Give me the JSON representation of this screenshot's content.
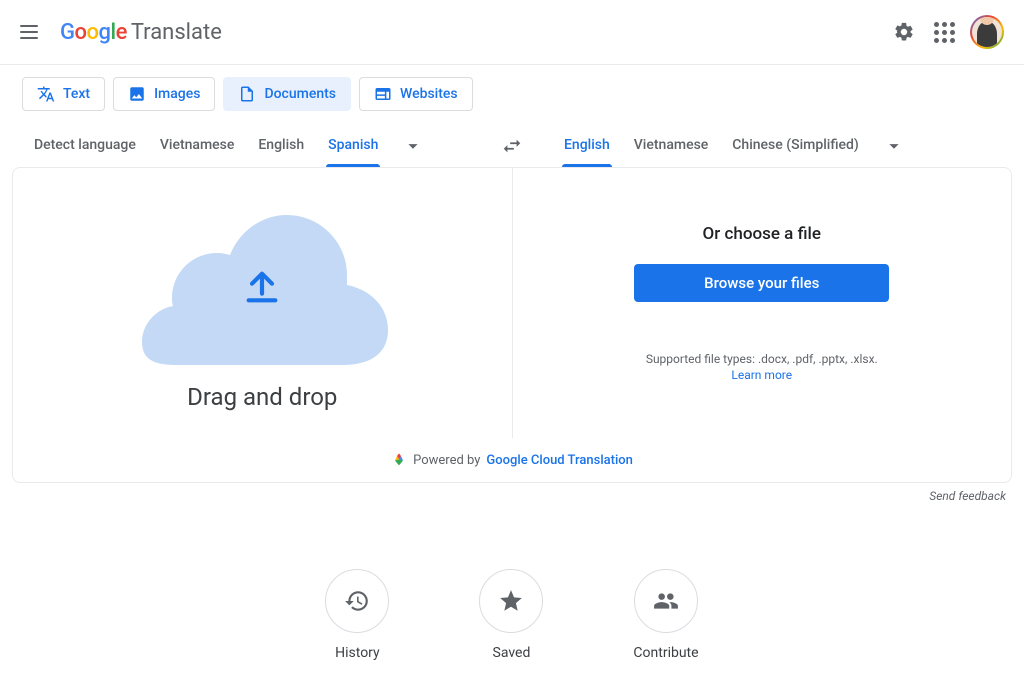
{
  "header": {
    "logo_google": "Google",
    "logo_translate": "Translate"
  },
  "input_tabs": [
    {
      "label": "Text",
      "icon": "translate-icon"
    },
    {
      "label": "Images",
      "icon": "image-icon"
    },
    {
      "label": "Documents",
      "icon": "document-icon"
    },
    {
      "label": "Websites",
      "icon": "website-icon"
    }
  ],
  "source_langs": {
    "items": [
      "Detect language",
      "Vietnamese",
      "English",
      "Spanish"
    ],
    "active_index": 3
  },
  "target_langs": {
    "items": [
      "English",
      "Vietnamese",
      "Chinese (Simplified)"
    ],
    "active_index": 0
  },
  "drop_area": {
    "drag_label": "Drag and drop"
  },
  "choose": {
    "title": "Or choose a file",
    "browse_label": "Browse your files",
    "supported_label": "Supported file types: .docx, .pdf, .pptx, .xlsx.",
    "learn_more": "Learn more"
  },
  "powered": {
    "prefix": "Powered by ",
    "link": "Google Cloud Translation"
  },
  "feedback_label": "Send feedback",
  "bottom_actions": [
    {
      "label": "History",
      "icon": "history-icon"
    },
    {
      "label": "Saved",
      "icon": "star-icon"
    },
    {
      "label": "Contribute",
      "icon": "people-icon"
    }
  ]
}
